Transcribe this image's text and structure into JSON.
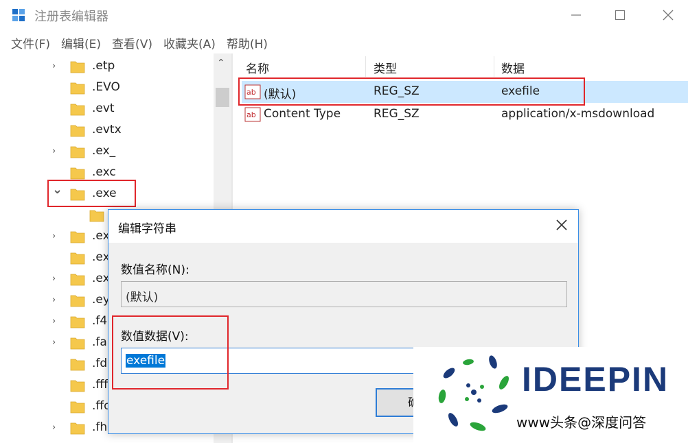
{
  "window": {
    "title": "注册表编辑器",
    "minimize_glyph": "—",
    "maximize_glyph": "☐",
    "close_glyph": "✕"
  },
  "menu": [
    "文件(F)",
    "编辑(E)",
    "查看(V)",
    "收藏夹(A)",
    "帮助(H)"
  ],
  "tree": {
    "items": [
      {
        "label": ".etp",
        "chevron": "›"
      },
      {
        "label": ".EVO",
        "chevron": ""
      },
      {
        "label": ".evt",
        "chevron": ""
      },
      {
        "label": ".evtx",
        "chevron": ""
      },
      {
        "label": ".ex_",
        "chevron": "›"
      },
      {
        "label": ".exc",
        "chevron": ""
      },
      {
        "label": ".exe",
        "chevron": "⌄",
        "expanded": true
      },
      {
        "label": "",
        "chevron": "",
        "child": true
      },
      {
        "label": ".ex",
        "chevron": "›"
      },
      {
        "label": ".ex",
        "chevron": ""
      },
      {
        "label": ".ex",
        "chevron": "›"
      },
      {
        "label": ".ey",
        "chevron": "›"
      },
      {
        "label": ".f4",
        "chevron": "›"
      },
      {
        "label": ".fa",
        "chevron": "›"
      },
      {
        "label": ".fd",
        "chevron": ""
      },
      {
        "label": ".fff",
        "chevron": ""
      },
      {
        "label": ".ffo",
        "chevron": ""
      },
      {
        "label": ".fh",
        "chevron": "›"
      }
    ],
    "scroll_up_glyph": "⌃"
  },
  "list": {
    "columns": [
      "名称",
      "类型",
      "数据"
    ],
    "rows": [
      {
        "name": "(默认)",
        "type": "REG_SZ",
        "data": "exefile",
        "selected": true
      },
      {
        "name": "Content Type",
        "type": "REG_SZ",
        "data": "application/x-msdownload",
        "selected": false
      }
    ]
  },
  "dialog": {
    "title": "编辑字符串",
    "name_label": "数值名称(N):",
    "name_value": "(默认)",
    "value_label": "数值数据(V):",
    "value_value": "exefile",
    "ok_button": "确"
  },
  "watermark": {
    "brand": "IDEEPIN",
    "credit": "www头条@深度问答"
  },
  "colors": {
    "highlight": "#e0262b",
    "selection": "#cce8ff",
    "accent": "#0078d7",
    "folder": "#f5c84c"
  }
}
